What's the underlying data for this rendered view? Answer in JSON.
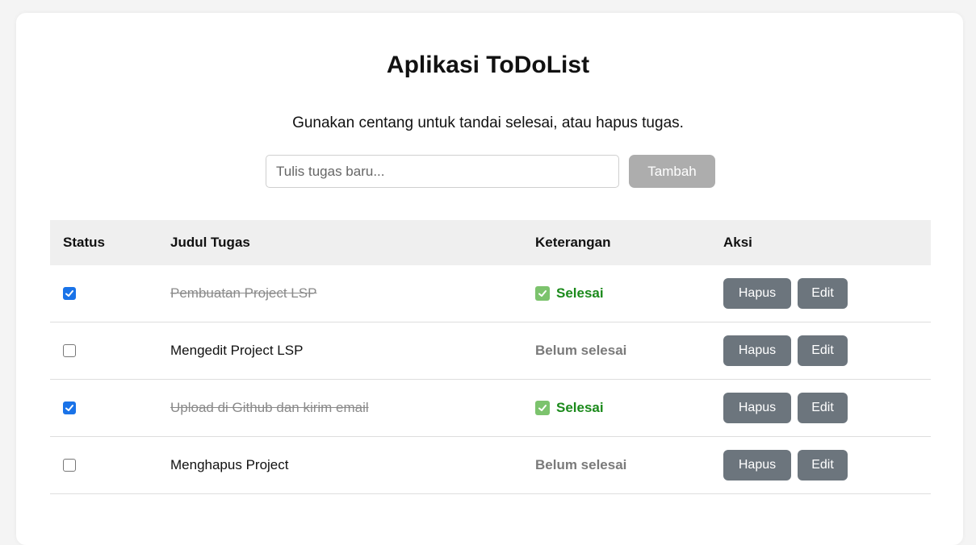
{
  "header": {
    "title": "Aplikasi ToDoList",
    "subtitle": "Gunakan centang untuk tandai selesai, atau hapus tugas."
  },
  "form": {
    "input_value": "",
    "input_placeholder": "Tulis tugas baru...",
    "add_label": "Tambah"
  },
  "table": {
    "columns": [
      "Status",
      "Judul Tugas",
      "Keterangan",
      "Aksi"
    ],
    "rows": [
      {
        "checked": true,
        "title": "Pembuatan Project LSP",
        "status": "Selesai",
        "delete_label": "Hapus",
        "edit_label": "Edit"
      },
      {
        "checked": false,
        "title": "Mengedit Project LSP",
        "status": "Belum selesai",
        "delete_label": "Hapus",
        "edit_label": "Edit"
      },
      {
        "checked": true,
        "title": "Upload di Github dan kirim email",
        "status": "Selesai",
        "delete_label": "Hapus",
        "edit_label": "Edit"
      },
      {
        "checked": false,
        "title": "Menghapus Project",
        "status": "Belum selesai",
        "delete_label": "Hapus",
        "edit_label": "Edit"
      }
    ]
  },
  "colors": {
    "checkbox_checked": "#1a73e8",
    "status_done": "#1b8a1b",
    "status_pending": "#7a7a7a",
    "button_disabled": "#adadad",
    "button_action": "#6c757d"
  },
  "icons": {
    "checked": "checkbox-checked-icon",
    "done": "check-mark-icon"
  }
}
